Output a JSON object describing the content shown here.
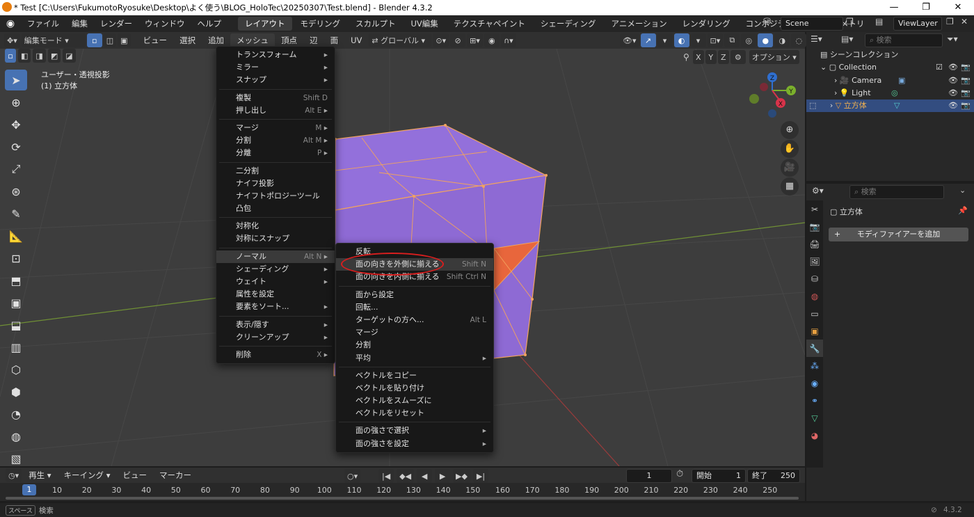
{
  "window": {
    "title": "* Test [C:\\Users\\FukumotoRyosuke\\Desktop\\よく使う\\BLOG_HoloTec\\20250307\\Test.blend] - Blender 4.3.2",
    "minimize": "—",
    "restore": "❐",
    "close": "✕"
  },
  "topbar": {
    "menus": [
      "ファイル",
      "編集",
      "レンダー",
      "ウィンドウ",
      "ヘルプ"
    ],
    "workspaces": [
      "レイアウト",
      "モデリング",
      "スカルプト",
      "UV編集",
      "テクスチャペイント",
      "シェーディング",
      "アニメーション",
      "レンダリング",
      "コンポジティング",
      "ジオメトリ"
    ],
    "scene": "Scene",
    "view_layer": "ViewLayer"
  },
  "viewport_header": {
    "mode": "編集モード",
    "menus": [
      "ビュー",
      "選択",
      "追加",
      "メッシュ",
      "頂点",
      "辺",
      "面",
      "UV"
    ],
    "transform_orientation": "グローバル",
    "axes": [
      "X",
      "Y",
      "Z"
    ],
    "options": "オプション"
  },
  "viewport": {
    "view_name": "ユーザー・透視投影",
    "object_label": "(1) 立方体",
    "gizmo": {
      "z": "Z",
      "y": "Y",
      "x": "X"
    }
  },
  "mesh_menu": {
    "groups": [
      [
        {
          "label": "トランスフォーム",
          "sc": "",
          "sub": true
        },
        {
          "label": "ミラー",
          "sc": "",
          "sub": true
        },
        {
          "label": "スナップ",
          "sc": "",
          "sub": true
        }
      ],
      [
        {
          "label": "複製",
          "sc": "Shift D",
          "sub": false
        },
        {
          "label": "押し出し",
          "sc": "Alt E",
          "sub": true
        }
      ],
      [
        {
          "label": "マージ",
          "sc": "M",
          "sub": true
        },
        {
          "label": "分割",
          "sc": "Alt M",
          "sub": true
        },
        {
          "label": "分離",
          "sc": "P",
          "sub": true
        }
      ],
      [
        {
          "label": "二分割",
          "sc": "",
          "sub": false
        },
        {
          "label": "ナイフ投影",
          "sc": "",
          "sub": false
        },
        {
          "label": "ナイフトポロジーツール",
          "sc": "",
          "sub": false
        },
        {
          "label": "凸包",
          "sc": "",
          "sub": false
        }
      ],
      [
        {
          "label": "対称化",
          "sc": "",
          "sub": false
        },
        {
          "label": "対称にスナップ",
          "sc": "",
          "sub": false
        }
      ],
      [
        {
          "label": "ノーマル",
          "sc": "Alt N",
          "sub": true,
          "hl": true
        },
        {
          "label": "シェーディング",
          "sc": "",
          "sub": true
        },
        {
          "label": "ウェイト",
          "sc": "",
          "sub": true
        },
        {
          "label": "属性を設定",
          "sc": "",
          "sub": false
        },
        {
          "label": "要素をソート...",
          "sc": "",
          "sub": true
        }
      ],
      [
        {
          "label": "表示/隠す",
          "sc": "",
          "sub": true
        },
        {
          "label": "クリーンアップ",
          "sc": "",
          "sub": true
        }
      ],
      [
        {
          "label": "削除",
          "sc": "X",
          "sub": true
        }
      ]
    ]
  },
  "normals_menu": {
    "groups": [
      [
        {
          "label": "反転",
          "sc": "",
          "sub": false
        },
        {
          "label": "面の向きを外側に揃える",
          "sc": "Shift N",
          "sub": false,
          "hl": true
        },
        {
          "label": "面の向きを内側に揃える",
          "sc": "Shift Ctrl N",
          "sub": false
        }
      ],
      [
        {
          "label": "面から設定",
          "sc": "",
          "sub": false
        },
        {
          "label": "回転...",
          "sc": "",
          "sub": false
        },
        {
          "label": "ターゲットの方へ...",
          "sc": "Alt L",
          "sub": false
        },
        {
          "label": "マージ",
          "sc": "",
          "sub": false
        },
        {
          "label": "分割",
          "sc": "",
          "sub": false
        },
        {
          "label": "平均",
          "sc": "",
          "sub": true
        }
      ],
      [
        {
          "label": "ベクトルをコピー",
          "sc": "",
          "sub": false
        },
        {
          "label": "ベクトルを貼り付け",
          "sc": "",
          "sub": false
        },
        {
          "label": "ベクトルをスムーズに",
          "sc": "",
          "sub": false
        },
        {
          "label": "ベクトルをリセット",
          "sc": "",
          "sub": false
        }
      ],
      [
        {
          "label": "面の強さで選択",
          "sc": "",
          "sub": true
        },
        {
          "label": "面の強さを設定",
          "sc": "",
          "sub": true
        }
      ]
    ]
  },
  "outliner": {
    "search_placeholder": "検索",
    "scene_collection": "シーンコレクション",
    "collection": "Collection",
    "items": [
      "Camera",
      "Light",
      "立方体"
    ]
  },
  "properties": {
    "search_placeholder": "検索",
    "object_name": "立方体",
    "add_modifier": "モディファイアーを追加"
  },
  "timeline": {
    "menus": [
      "再生",
      "キーイング",
      "ビュー",
      "マーカー"
    ],
    "current_frame": "1",
    "start_label": "開始",
    "start": "1",
    "end_label": "終了",
    "end": "250",
    "ticks": [
      "10",
      "20",
      "30",
      "40",
      "50",
      "60",
      "70",
      "80",
      "90",
      "100",
      "110",
      "120",
      "130",
      "140",
      "150",
      "160",
      "170",
      "180",
      "190",
      "200",
      "210",
      "220",
      "230",
      "240",
      "250"
    ],
    "playhead": "1"
  },
  "status": {
    "key": "スペース",
    "action": "検索",
    "version": "4.3.2"
  },
  "colors": {
    "accent": "#4772b3",
    "face": "#9370db",
    "active_face": "#e8663c",
    "edge": "#f2a35e",
    "annotation": "#d91e1e"
  }
}
